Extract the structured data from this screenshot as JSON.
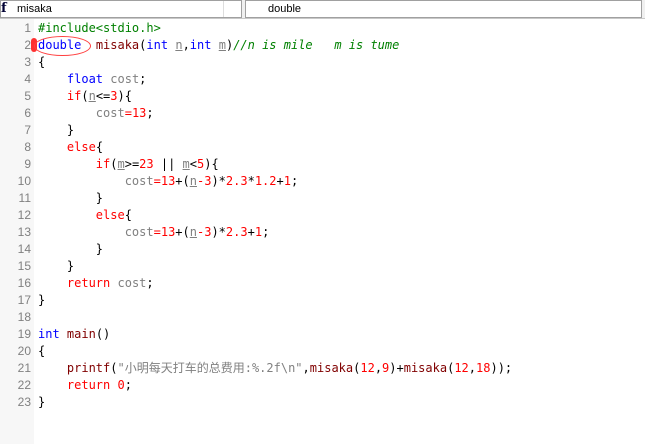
{
  "toolbar": {
    "scope_icon": "function-icon",
    "scope_label": "misaka",
    "symbol_label": "double"
  },
  "editor": {
    "lines": [
      [
        [
          "pre",
          "#include<stdio.h>"
        ]
      ],
      [
        [
          "kw",
          "double"
        ],
        [
          "p",
          "  "
        ],
        [
          "fn",
          "misaka"
        ],
        [
          "p",
          "("
        ],
        [
          "kw",
          "int"
        ],
        [
          "p",
          " "
        ],
        [
          "param",
          "n"
        ],
        [
          "p",
          ","
        ],
        [
          "kw",
          "int"
        ],
        [
          "p",
          " "
        ],
        [
          "param",
          "m"
        ],
        [
          "p",
          ")"
        ],
        [
          "cm",
          "//n is mile   m is tume"
        ]
      ],
      [
        [
          "p",
          "{"
        ]
      ],
      [
        [
          "p",
          "    "
        ],
        [
          "kw",
          "float"
        ],
        [
          "p",
          " "
        ],
        [
          "var",
          "cost"
        ],
        [
          "p",
          ";"
        ]
      ],
      [
        [
          "p",
          "    "
        ],
        [
          "ctl",
          "if"
        ],
        [
          "p",
          "("
        ],
        [
          "param",
          "n"
        ],
        [
          "p",
          "<="
        ],
        [
          "num",
          "3"
        ],
        [
          "p",
          "){"
        ]
      ],
      [
        [
          "p",
          "        "
        ],
        [
          "var",
          "cost"
        ],
        [
          "ctl",
          "="
        ],
        [
          "num",
          "13"
        ],
        [
          "p",
          ";"
        ]
      ],
      [
        [
          "p",
          "    }"
        ]
      ],
      [
        [
          "p",
          "    "
        ],
        [
          "ctl",
          "else"
        ],
        [
          "p",
          "{"
        ]
      ],
      [
        [
          "p",
          "        "
        ],
        [
          "ctl",
          "if"
        ],
        [
          "p",
          "("
        ],
        [
          "param",
          "m"
        ],
        [
          "p",
          ">="
        ],
        [
          "num",
          "23"
        ],
        [
          "p",
          " || "
        ],
        [
          "param",
          "m"
        ],
        [
          "p",
          "<"
        ],
        [
          "num",
          "5"
        ],
        [
          "p",
          "){"
        ]
      ],
      [
        [
          "p",
          "            "
        ],
        [
          "var",
          "cost"
        ],
        [
          "ctl",
          "="
        ],
        [
          "num",
          "13"
        ],
        [
          "p",
          "+("
        ],
        [
          "param",
          "n"
        ],
        [
          "ctl",
          "-"
        ],
        [
          "num",
          "3"
        ],
        [
          "p",
          ")*"
        ],
        [
          "num",
          "2.3"
        ],
        [
          "p",
          "*"
        ],
        [
          "num",
          "1.2"
        ],
        [
          "p",
          "+"
        ],
        [
          "num",
          "1"
        ],
        [
          "p",
          ";"
        ]
      ],
      [
        [
          "p",
          "        }"
        ]
      ],
      [
        [
          "p",
          "        "
        ],
        [
          "ctl",
          "else"
        ],
        [
          "p",
          "{"
        ]
      ],
      [
        [
          "p",
          "            "
        ],
        [
          "var",
          "cost"
        ],
        [
          "ctl",
          "="
        ],
        [
          "num",
          "13"
        ],
        [
          "p",
          "+("
        ],
        [
          "param",
          "n"
        ],
        [
          "ctl",
          "-"
        ],
        [
          "num",
          "3"
        ],
        [
          "p",
          ")*"
        ],
        [
          "num",
          "2.3"
        ],
        [
          "p",
          "+"
        ],
        [
          "num",
          "1"
        ],
        [
          "p",
          ";"
        ]
      ],
      [
        [
          "p",
          "        }"
        ]
      ],
      [
        [
          "p",
          "    }"
        ]
      ],
      [
        [
          "p",
          "    "
        ],
        [
          "ctl",
          "return"
        ],
        [
          "p",
          " "
        ],
        [
          "var",
          "cost"
        ],
        [
          "p",
          ";"
        ]
      ],
      [
        [
          "p",
          "}"
        ]
      ],
      [],
      [
        [
          "kw",
          "int"
        ],
        [
          "p",
          " "
        ],
        [
          "fn",
          "main"
        ],
        [
          "p",
          "()"
        ]
      ],
      [
        [
          "p",
          "{"
        ]
      ],
      [
        [
          "p",
          "    "
        ],
        [
          "fn",
          "printf"
        ],
        [
          "p",
          "("
        ],
        [
          "str",
          "\"小明每天打车的总费用:%.2f\\n\""
        ],
        [
          "p",
          ","
        ],
        [
          "fn",
          "misaka"
        ],
        [
          "p",
          "("
        ],
        [
          "num",
          "12"
        ],
        [
          "p",
          ","
        ],
        [
          "num",
          "9"
        ],
        [
          "p",
          ")+"
        ],
        [
          "fn",
          "misaka"
        ],
        [
          "p",
          "("
        ],
        [
          "num",
          "12"
        ],
        [
          "p",
          ","
        ],
        [
          "num",
          "18"
        ],
        [
          "p",
          "));"
        ]
      ],
      [
        [
          "p",
          "    "
        ],
        [
          "ctl",
          "return"
        ],
        [
          "p",
          " "
        ],
        [
          "num",
          "0"
        ],
        [
          "p",
          ";"
        ]
      ],
      [
        [
          "p",
          "}"
        ]
      ]
    ]
  }
}
